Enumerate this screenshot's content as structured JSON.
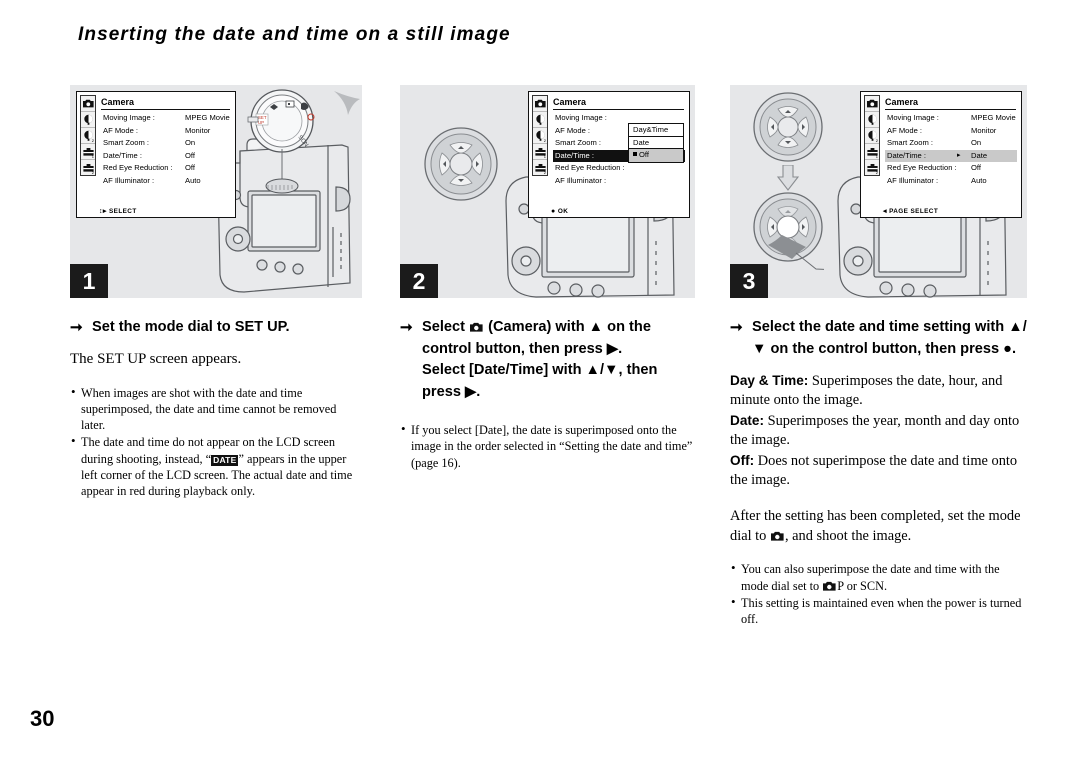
{
  "page": {
    "heading": "Inserting the date and time on a still image",
    "number": "30"
  },
  "menu_icons": {
    "camera": "camera-icon",
    "flash1": "flash-adjust-icon-1",
    "flash2": "flash-adjust-icon-2",
    "setup1": "setup-toolbox-icon-1",
    "setup2": "setup-toolbox-icon-2"
  },
  "steps": [
    {
      "badge": "1",
      "lcd": {
        "title": "Camera",
        "rows": [
          {
            "label": "Moving Image :",
            "value": "MPEG Movie",
            "state": "normal"
          },
          {
            "label": "AF Mode :",
            "value": "Monitor",
            "state": "normal"
          },
          {
            "label": "Smart Zoom :",
            "value": "On",
            "state": "normal"
          },
          {
            "label": "Date/Time :",
            "value": "Off",
            "state": "normal"
          },
          {
            "label": "Red Eye Reduction :",
            "value": "Off",
            "state": "normal"
          },
          {
            "label": "AF Illuminator :",
            "value": "Auto",
            "state": "normal"
          }
        ],
        "footer": "SELECT",
        "footer_glyph": "updown-right-icon"
      },
      "dial": {
        "name": "mode-dial",
        "position_label": "SET UP",
        "labels": [
          "SET UP",
          "SCN"
        ]
      },
      "heading_lines": [
        "Set the mode dial to SET UP."
      ],
      "lead": "The SET UP screen appears.",
      "bullets": [
        "When images are shot with the date and time superimposed, the date and time cannot be removed later.",
        "The date and time do not appear on the LCD screen during shooting, instead, “■DATE■” appears in the upper left corner of the LCD screen. The actual date and time appear in red during playback only."
      ]
    },
    {
      "badge": "2",
      "lcd": {
        "title": "Camera",
        "rows": [
          {
            "label": "Moving Image :",
            "value": "",
            "state": "normal"
          },
          {
            "label": "AF Mode :",
            "value": "",
            "state": "normal"
          },
          {
            "label": "Smart Zoom :",
            "value": "",
            "state": "normal"
          },
          {
            "label": "Date/Time :",
            "value": "",
            "state": "selected"
          },
          {
            "label": "Red Eye Reduction :",
            "value": "",
            "state": "normal"
          },
          {
            "label": "AF Illuminator :",
            "value": "",
            "state": "normal"
          }
        ],
        "footer": "OK",
        "footer_glyph": "center-button-icon"
      },
      "submenu": {
        "options": [
          "Day&Time",
          "Date",
          "Off"
        ],
        "current": "Off"
      },
      "heading_lines": [
        "Select ■ (Camera) with ▲ on the control button, then press ▶.",
        "Select [Date/Time] with ▲/▼, then press ▶."
      ],
      "bullets": [
        "If you select [Date], the date is superimposed onto the image in the order selected in “Setting the date and time” (page 16)."
      ]
    },
    {
      "badge": "3",
      "lcd": {
        "title": "Camera",
        "rows": [
          {
            "label": "Moving Image :",
            "value": "MPEG Movie",
            "state": "normal"
          },
          {
            "label": "AF Mode :",
            "value": "Monitor",
            "state": "normal"
          },
          {
            "label": "Smart Zoom :",
            "value": "On",
            "state": "normal"
          },
          {
            "label": "Date/Time :",
            "value": "Date",
            "state": "highlight"
          },
          {
            "label": "Red Eye Reduction :",
            "value": "Off",
            "state": "normal"
          },
          {
            "label": "AF Illuminator :",
            "value": "Auto",
            "state": "normal"
          }
        ],
        "footer": "PAGE SELECT",
        "footer_glyph": "left-arrow-icon"
      },
      "heading_lines": [
        "Select the date and time setting with ▲/▼ on the control button, then press ●."
      ],
      "definitions": [
        {
          "term": "Day & Time:",
          "text": " Superimposes the date, hour, and minute onto the image."
        },
        {
          "term": "Date:",
          "text": " Superimposes the year, month and day onto the image."
        },
        {
          "term": "Off:",
          "text": " Does not superimpose the date and time onto the image."
        }
      ],
      "after_note": "After the setting has been completed, set the mode dial to ■, and shoot the image.",
      "bullets": [
        "You can also superimpose the date and time with the mode dial set to ■P or SCN.",
        "This setting is maintained even when the power is turned off."
      ]
    }
  ],
  "step1_heading_text": "Set the mode dial to SET UP.",
  "step1_lead": "The SET UP screen appears.",
  "step1_bullet1": "When images are shot with the date and time superimposed, the date and time cannot be removed later.",
  "step1_bullet2_a": "The date and time do not appear on the LCD screen during shooting, instead, “",
  "step1_bullet2_badge": "DATE",
  "step1_bullet2_b": "” appears in the upper left corner of the LCD screen. The actual date and time appear in red during playback only.",
  "step2_head_a": "Select ",
  "step2_head_b": " (Camera) with ▲ on the control button, then press ▶.",
  "step2_head_c": "Select [Date/Time] with ▲/▼, then press ▶.",
  "step2_bullet1": "If you select [Date], the date is superimposed onto the image in the order selected in “Setting the date and time” (page 16).",
  "step3_head": "Select the date and time setting with ▲/▼ on the control button, then press ●.",
  "step3_def1_term": "Day & Time:",
  "step3_def1_text": " Superimposes the date, hour, and minute onto the image.",
  "step3_def2_term": "Date:",
  "step3_def2_text": " Superimposes the year, month and day onto the image.",
  "step3_def3_term": "Off:",
  "step3_def3_text": " Does not superimpose the date and time onto the image.",
  "step3_after_a": "After the setting has been completed, set the mode dial to ",
  "step3_after_b": ", and shoot the image.",
  "step3_bullet1_a": "You can also superimpose the date and time with the mode dial set to ",
  "step3_bullet1_b": "P or SCN.",
  "step3_bullet2": "This setting is maintained even when the power is turned off.",
  "colors": {
    "panel_bg": "#e6e7e9",
    "badge_bg": "#1b1b1b",
    "selected_row": "#111111",
    "highlight_row": "#c9c9c9",
    "ink": "#000000"
  }
}
